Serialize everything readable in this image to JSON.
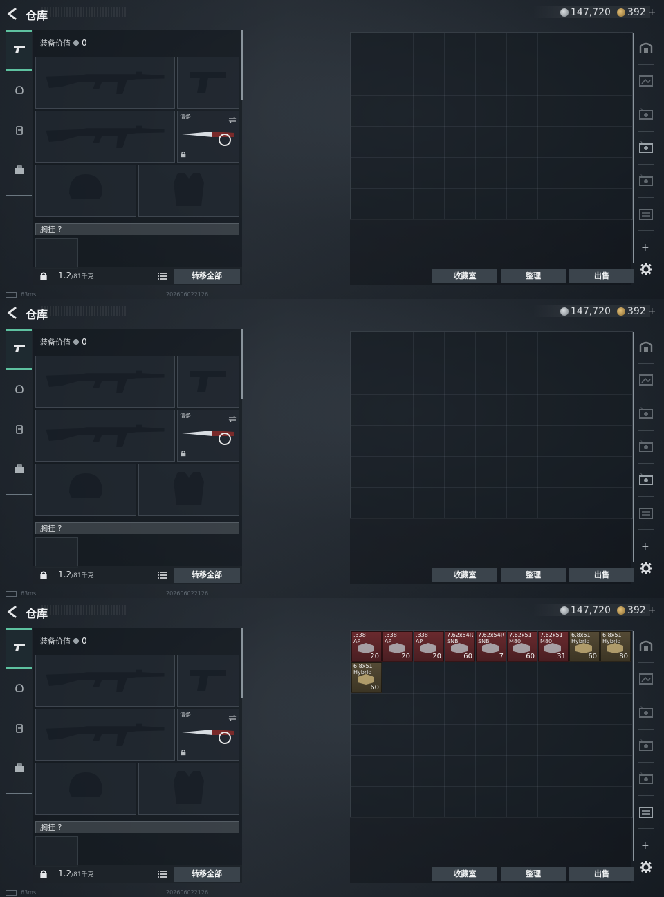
{
  "screens": [
    {
      "title": "仓库",
      "silver": "147,720",
      "gold": "392",
      "gold_suffix": "+",
      "equip_value_label": "装备价值",
      "equip_value": "0",
      "melee_label": "信条",
      "chest_label": "胸挂 ?",
      "weight": "1.2",
      "weight_max": "/81千克",
      "transfer_all": "转移全部",
      "collect": "收藏室",
      "sort": "整理",
      "sell": "出售",
      "ping": "63ms",
      "stamp": "202606022126"
    },
    {
      "title": "仓库",
      "silver": "147,720",
      "gold": "392",
      "gold_suffix": "+",
      "equip_value_label": "装备价值",
      "equip_value": "0",
      "melee_label": "信条",
      "chest_label": "胸挂 ?",
      "weight": "1.2",
      "weight_max": "/81千克",
      "transfer_all": "转移全部",
      "collect": "收藏室",
      "sort": "整理",
      "sell": "出售",
      "ping": "63ms",
      "stamp": "202606022126"
    },
    {
      "title": "仓库",
      "silver": "147,720",
      "gold": "392",
      "gold_suffix": "+",
      "equip_value_label": "装备价值",
      "equip_value": "0",
      "melee_label": "信条",
      "chest_label": "胸挂 ?",
      "weight": "1.2",
      "weight_max": "/81千克",
      "transfer_all": "转移全部",
      "collect": "收藏室",
      "sort": "整理",
      "sell": "出售",
      "ping": "63ms",
      "stamp": "202606022126"
    }
  ],
  "screen1": {
    "active_tab": "tab-4"
  },
  "screen2": {
    "active_tab": "tab-5"
  },
  "screen3": {
    "active_tab": "tab-6",
    "ammo": [
      {
        "cal": ".338",
        "sub": "AP",
        "count": "20",
        "tier": "red"
      },
      {
        "cal": ".338",
        "sub": "AP",
        "count": "20",
        "tier": "red"
      },
      {
        "cal": ".338",
        "sub": "AP",
        "count": "20",
        "tier": "red"
      },
      {
        "cal": "7.62x54R",
        "sub": "SNB",
        "count": "60",
        "tier": "red"
      },
      {
        "cal": "7.62x54R",
        "sub": "SNB",
        "count": "7",
        "tier": "red"
      },
      {
        "cal": "7.62x51",
        "sub": "M80",
        "count": "60",
        "tier": "red"
      },
      {
        "cal": "7.62x51",
        "sub": "M80",
        "count": "31",
        "tier": "red"
      },
      {
        "cal": "6.8x51",
        "sub": "Hybrid",
        "count": "60",
        "tier": "gold"
      },
      {
        "cal": "6.8x51",
        "sub": "Hybrid",
        "count": "80",
        "tier": "gold"
      },
      {
        "cal": "6.8x51",
        "sub": "Hybrid",
        "count": "60",
        "tier": "gold"
      }
    ]
  },
  "icons": {
    "back": "back-arrow-icon",
    "silver": "silver-coin-icon",
    "gold": "gold-coin-icon",
    "gun": "gun-icon",
    "helmet": "helmet-icon",
    "backpack": "backpack-icon",
    "briefcase": "briefcase-icon",
    "settings": "gear-icon",
    "list": "list-icon",
    "lock": "lock-icon",
    "swap": "swap-icon",
    "plus": "plus-icon"
  },
  "colors": {
    "accent": "#5ec2a0",
    "ammo_red": "#6a2a2e",
    "ammo_gold": "#544a35"
  }
}
